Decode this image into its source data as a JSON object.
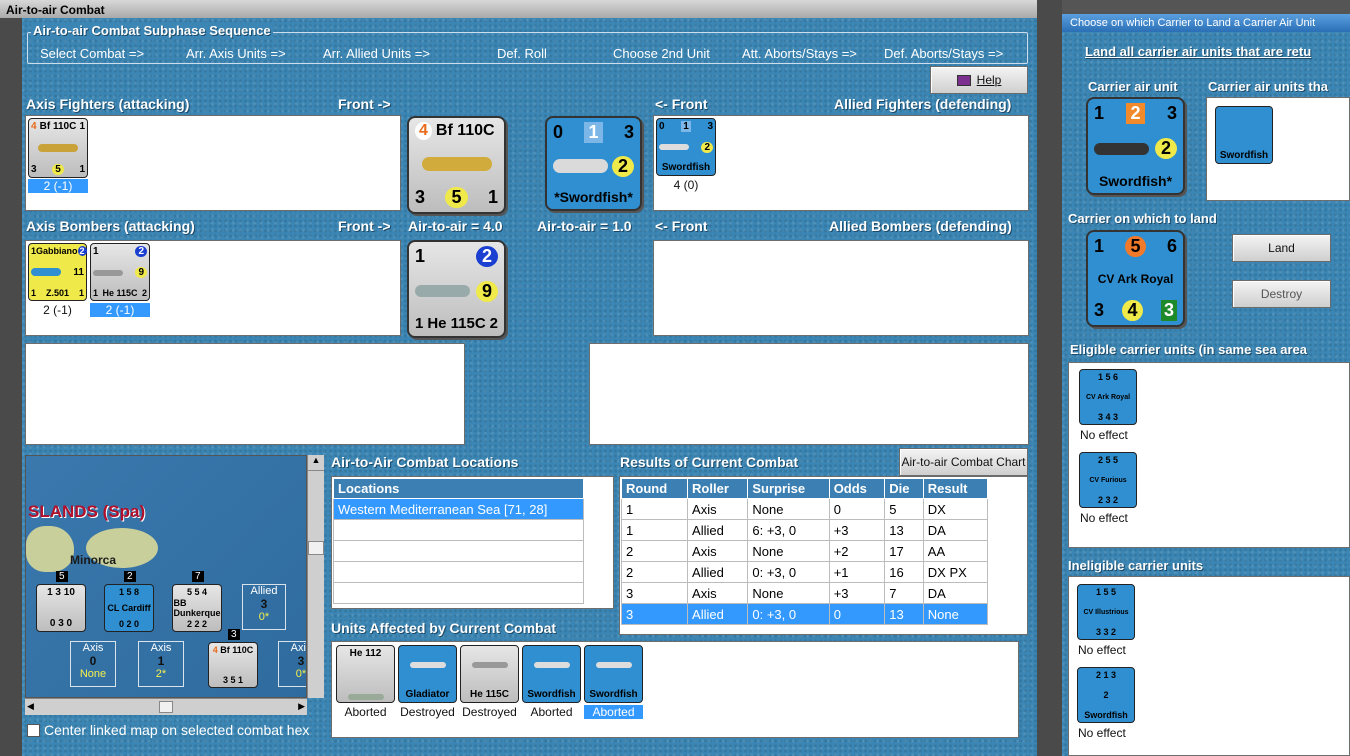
{
  "window": {
    "title": "Air-to-air Combat"
  },
  "sequence": {
    "title": "Air-to-air Combat Subphase Sequence",
    "steps": [
      "Select Combat =>",
      "Arr. Axis Units =>",
      "Arr. Allied Units =>",
      "Def. Roll",
      "Choose 2nd Unit",
      "Att. Aborts/Stays =>",
      "Def. Aborts/Stays =>"
    ]
  },
  "help_label": "Help",
  "axis_fighters": {
    "title": "Axis Fighters (attacking)",
    "front": "Front ->",
    "unit": {
      "name": "Bf 110C",
      "top_left": "4",
      "top_right": "1",
      "bottom_left": "3",
      "bottom_mid": "5",
      "bottom_right": "1",
      "label": "2 (-1)"
    }
  },
  "axis_bombers": {
    "title": "Axis Bombers (attacking)",
    "front": "Front ->",
    "units": [
      {
        "name": "Z.501",
        "subname": "Gabbiano",
        "top_left": "1",
        "top_right": "2",
        "bottom_left": "1",
        "bottom_mid": "11",
        "bottom_right": "1",
        "label": "2 (-1)"
      },
      {
        "name": "He 115C",
        "top_left": "1",
        "top_right": "2",
        "bottom_left": "1",
        "bottom_mid": "9",
        "bottom_right": "2",
        "label": "2 (-1)"
      }
    ]
  },
  "axis_front_fighter": {
    "name": "Bf 110C",
    "top_left": "4",
    "bottom_left": "3",
    "bottom_mid": "5",
    "bottom_right": "1"
  },
  "axis_front_bomber": {
    "name": "He 115C",
    "top_left": "1",
    "top_right": "2",
    "bottom_left": "1",
    "bottom_mid": "9",
    "bottom_right": "2"
  },
  "air_to_air_axis": "Air-to-air = 4.0",
  "air_to_air_allied": "Air-to-air = 1.0",
  "allied_front_fighter": {
    "name": "*Swordfish*",
    "top_left": "0",
    "top_mid": "1",
    "top_right": "3",
    "bottom_right": "2"
  },
  "allied_fighters": {
    "title": "Allied Fighters (defending)",
    "front": "<- Front",
    "unit": {
      "name": "Swordfish",
      "top_left": "0",
      "top_mid": "1",
      "top_right": "3",
      "bottom_right": "2",
      "label": "4 (0)"
    }
  },
  "allied_bombers": {
    "title": "Allied Bombers (defending)",
    "front": "<- Front"
  },
  "map": {
    "title": "SLANDS (Spa)",
    "island": "Minorca",
    "stacks": [
      {
        "count": "5",
        "vals": "1 3 10",
        "low": "0 3 0"
      },
      {
        "count": "2",
        "name": "CL Cardiff",
        "vals": "1 5 8",
        "low": "0 2 0"
      },
      {
        "count": "7",
        "name": "BB Dunkerque",
        "vals": "5 5 4",
        "low": "2 2 2"
      }
    ],
    "boxes": [
      {
        "side": "Allied",
        "num": "3",
        "sub": "0*"
      },
      {
        "side": "Axis",
        "num": "0",
        "sub": "None"
      },
      {
        "side": "Axis",
        "num": "1",
        "sub": "2*"
      },
      {
        "side": "Axis",
        "num": "3",
        "sub": "0*"
      }
    ],
    "bf_counter": {
      "count": "3",
      "name": "Bf 110C",
      "top_left": "4",
      "bottom": "3 5 1"
    },
    "center_label": "Center linked map on selected combat hex"
  },
  "locations": {
    "title": "Air-to-Air Combat Locations",
    "header": "Locations",
    "items": [
      "Western Mediterranean Sea [71, 28]"
    ]
  },
  "results": {
    "title": "Results of Current Combat",
    "chart_btn": "Air-to-air Combat Chart",
    "headers": [
      "Round",
      "Roller",
      "Surprise",
      "Odds",
      "Die",
      "Result"
    ],
    "rows": [
      [
        "1",
        "Axis",
        "None",
        "0",
        "5",
        "DX"
      ],
      [
        "1",
        "Allied",
        "6: +3, 0",
        "+3",
        "13",
        "DA"
      ],
      [
        "2",
        "Axis",
        "None",
        "+2",
        "17",
        "AA"
      ],
      [
        "2",
        "Allied",
        "0: +3, 0",
        "+1",
        "16",
        "DX PX"
      ],
      [
        "3",
        "Axis",
        "None",
        "+3",
        "7",
        "DA"
      ],
      [
        "3",
        "Allied",
        "0: +3, 0",
        "0",
        "13",
        "None"
      ]
    ]
  },
  "affected": {
    "title": "Units Affected by Current Combat",
    "units": [
      {
        "name": "He 112",
        "color": "grey",
        "status": "Aborted"
      },
      {
        "name": "Gladiator",
        "color": "blue",
        "status": "Destroyed"
      },
      {
        "name": "He 115C",
        "color": "grey",
        "status": "Destroyed"
      },
      {
        "name": "Swordfish",
        "color": "blue",
        "status": "Aborted"
      },
      {
        "name": "Swordfish",
        "color": "blue",
        "status": "Aborted"
      }
    ]
  },
  "right": {
    "title": "Choose on which Carrier to Land a Carrier Air Unit",
    "instruction": "Land all carrier air units that are retu",
    "carrier_air_head": "Carrier air unit",
    "carrier_units_head": "Carrier air units tha",
    "swordfish": {
      "name": "Swordfish*",
      "top_left": "1",
      "top_mid": "2",
      "top_right": "3",
      "bottom_right": "2"
    },
    "swordfish_small": "Swordfish",
    "carrier_land_head": "Carrier on which to land",
    "ark_royal": {
      "name": "CV Ark Royal",
      "top_left": "1",
      "top_mid": "5",
      "top_right": "6",
      "bottom_left": "3",
      "bottom_mid": "4",
      "bottom_right": "3"
    },
    "land_btn": "Land",
    "destroy_btn": "Destroy",
    "eligible_head": "Eligible carrier units (in same sea area",
    "eligible": [
      {
        "name": "CV Ark Royal",
        "top": "1 5 6",
        "bottom": "3 4 3",
        "status": "No effect"
      },
      {
        "name": "CV Furious",
        "top": "2 5 5",
        "bottom": "2 3 2",
        "status": "No effect"
      }
    ],
    "ineligible_head": "Ineligible carrier units",
    "ineligible": [
      {
        "name": "CV Illustrious",
        "top": "1 5 5",
        "bottom": "3 3 2",
        "status": "No effect"
      },
      {
        "name": "Swordfish",
        "top": "2 1 3",
        "bottom": "2",
        "status": "No effect"
      }
    ]
  }
}
